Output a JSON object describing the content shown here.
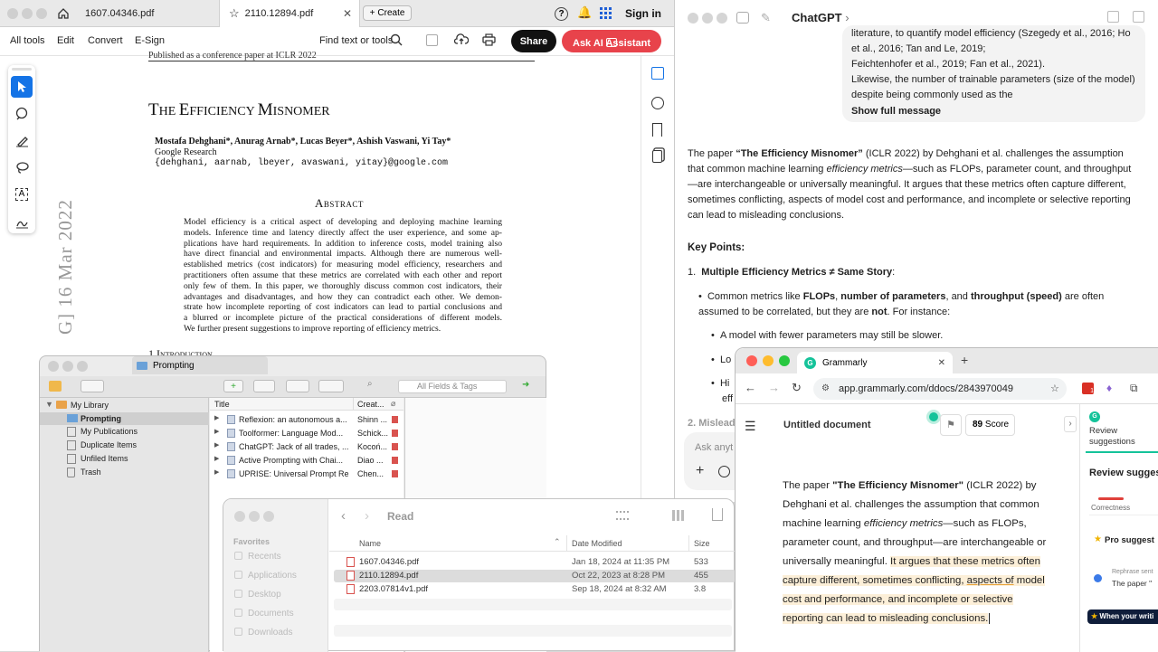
{
  "acrobat": {
    "tabs": [
      {
        "label": "1607.04346.pdf"
      },
      {
        "label": "2110.12894.pdf"
      }
    ],
    "create_label": "Create",
    "sign_in": "Sign in",
    "toolbar": {
      "all_tools": "All tools",
      "edit": "Edit",
      "convert": "Convert",
      "esign": "E-Sign",
      "find": "Find text or tools",
      "share": "Share",
      "ai": "Ask AI Assistant"
    },
    "pdf": {
      "header_note": "Published as a conference paper at ICLR 2022",
      "title_parts": [
        "T",
        "HE ",
        "E",
        "FFICIENCY ",
        "M",
        "ISNOMER"
      ],
      "authors": "Mostafa Dehghani*, Anurag Arnab*, Lucas Beyer*, Ashish Vaswani, Yi Tay*",
      "affiliation": "Google Research",
      "emails": "{dehghani, aarnab, lbeyer, avaswani, yitay}@google.com",
      "abstract_heading": "Abstract",
      "abstract_lines": [
        "Model efficiency is a critical aspect of developing and deploying machine learning",
        "models. Inference time and latency directly affect the user experience, and some ap-",
        "plications have hard requirements. In addition to inference costs, model training also",
        "have direct financial and environmental impacts. Although there are numerous well-",
        "established metrics (cost indicators) for measuring model efficiency, researchers and",
        "practitioners often assume that these metrics are correlated with each other and report",
        "only few of them. In this paper, we thoroughly discuss common cost indicators, their",
        "advantages and disadvantages, and how they can contradict each other. We demon-",
        "strate how incomplete reporting of cost indicators can lead to partial conclusions and",
        "a blurred or incomplete picture of the practical considerations of different models.",
        "We further present suggestions to improve reporting of efficiency metrics."
      ],
      "arxiv_stamp": "G]  16 Mar 2022",
      "section_heading": "1   Introduction"
    }
  },
  "chatgpt": {
    "title": "ChatGPT",
    "user_msg_lines": [
      "et al., 2016; Tan and Le, 2019;",
      "Feichtenhofer et al., 2019; Fan et al., 2021).",
      "Likewise, the number of trainable parameters (size of the model)",
      "despite being commonly used as the"
    ],
    "user_msg_top": "literature, to quantify model efficiency (Szegedy et al., 2016; Ho",
    "show_full": "Show full message",
    "intro_bold": "“The Efficiency Misnomer”",
    "intro_a": "The paper ",
    "intro_b": " (ICLR 2022) by Dehghani et al. challenges the assumption that common machine learning ",
    "intro_em": "efficiency metrics",
    "intro_c": "—such as FLOPs, parameter count, and throughput—are interchangeable or universally meaningful. It argues that these metrics often capture different, sometimes conflicting, aspects of model cost and performance, and incomplete or selective reporting can lead to misleading conclusions.",
    "key_points": "Key Points:",
    "point1": "Multiple Efficiency Metrics ≠ Same Story",
    "bullet_a": "Common metrics like ",
    "bullet_flops": "FLOPs",
    "bullet_params": "number of parameters",
    "bullet_and": ", and ",
    "bullet_tp": "throughput (speed)",
    "bullet_b": " are often assumed to be correlated, but they are ",
    "bullet_not": "not",
    "bullet_c": ". For instance:",
    "sub1": "A model with fewer parameters may still be slower.",
    "sub2": "Lo",
    "sub3": "Hi",
    "sub3b": "eff",
    "point2": "2.  Mislead",
    "ask_placeholder": "Ask anyt"
  },
  "zotero": {
    "title": "Prompting",
    "search_placeholder": "All Fields & Tags",
    "tree": [
      {
        "label": "My Library"
      },
      {
        "label": "Prompting"
      },
      {
        "label": "My Publications"
      },
      {
        "label": "Duplicate Items"
      },
      {
        "label": "Unfiled Items"
      },
      {
        "label": "Trash"
      }
    ],
    "col_title": "Title",
    "col_creator": "Creat...",
    "rows": [
      {
        "title": "Reflexion: an autonomous a...",
        "creator": "Shinn ..."
      },
      {
        "title": "Toolformer: Language Mod...",
        "creator": "Schick..."
      },
      {
        "title": "ChatGPT: Jack of all trades, ...",
        "creator": "Kocoń..."
      },
      {
        "title": "Active Prompting with Chai...",
        "creator": "Diao ..."
      },
      {
        "title": "UPRISE: Universal Prompt Re...",
        "creator": "Chen..."
      }
    ]
  },
  "finder": {
    "title": "Read",
    "sidebar_heading": "Favorites",
    "sidebar": [
      {
        "label": "Recents"
      },
      {
        "label": "Applications"
      },
      {
        "label": "Desktop"
      },
      {
        "label": "Documents"
      },
      {
        "label": "Downloads"
      }
    ],
    "col_name": "Name",
    "col_date": "Date Modified",
    "col_size": "Size",
    "files": [
      {
        "name": "1607.04346.pdf",
        "date": "Jan 18, 2024 at 11:35 PM",
        "size": "533"
      },
      {
        "name": "2110.12894.pdf",
        "date": "Oct 22, 2023 at 8:28 PM",
        "size": "455"
      },
      {
        "name": "2203.07814v1.pdf",
        "date": "Sep 18, 2024 at 8:32 AM",
        "size": "3.8"
      }
    ]
  },
  "grammarly": {
    "tab_title": "Grammarly",
    "url": "app.grammarly.com/ddocs/2843970049",
    "doc_title": "Untitled document",
    "score": "89",
    "score_label": "Score",
    "review_label_1": "Review",
    "review_label_2": "suggestions",
    "review_heading": "Review sugges",
    "correctness": "Correctness",
    "pro": "Pro suggest",
    "rephrase": "Rephrase sent",
    "rephrase_sub": "The paper \"",
    "when_writing": "When your writi",
    "p_a": "The paper ",
    "p_bold": "\"The Efficiency Misnomer\"",
    "p_b": " (ICLR 2022) by Dehghani et al. challenges the assumption that common machine learning ",
    "p_em": "efficiency metrics",
    "p_c": "—such as FLOPs, parameter count, and throughput—are interchangeable or universally meaningful. ",
    "p_hl1": "It argues that these metrics often capture different, sometimes conflicting, ",
    "p_hl_u": "aspects of",
    "p_hl2": " model cost and performance, and incomplete or selective reporting can lead to misleading conclusions."
  },
  "colors": {
    "accent_blue": "#1473e6",
    "ai_red": "#e8434b",
    "grammarly_green": "#15c39a"
  }
}
